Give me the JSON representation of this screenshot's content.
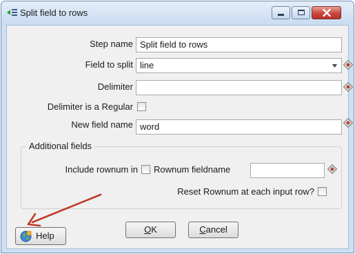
{
  "window": {
    "title": "Split field to rows",
    "controls": [
      "minimize",
      "maximize",
      "close"
    ]
  },
  "form": {
    "step_name_label": "Step name",
    "step_name_value": "Split field to rows",
    "field_to_split_label": "Field to split",
    "field_to_split_value": "line",
    "delimiter_label": "Delimiter",
    "delimiter_value": "",
    "delimiter_regex_label": "Delimiter is a Regular",
    "delimiter_regex_checked": false,
    "new_field_name_label": "New field name",
    "new_field_name_value": "word"
  },
  "additional": {
    "group_title": "Additional fields",
    "include_rownum_label": "Include rownum in",
    "include_rownum_checked": false,
    "rownum_fieldname_label": "Rownum fieldname",
    "rownum_fieldname_value": "",
    "reset_rownum_label": "Reset Rownum at each input row?",
    "reset_rownum_checked": false
  },
  "buttons": {
    "help": "Help",
    "ok": {
      "underlined": "O",
      "rest": "K"
    },
    "cancel": {
      "underlined": "C",
      "rest": "ancel"
    }
  },
  "colors": {
    "titlebar": "#c9dcf1",
    "close_button": "#c9463d",
    "annotation_arrow": "#c0392b"
  },
  "icons": {
    "app": "split-rows-icon",
    "variable": "variable-diamond-icon",
    "help": "help-globe-icon",
    "dropdown": "chevron-down-icon"
  }
}
